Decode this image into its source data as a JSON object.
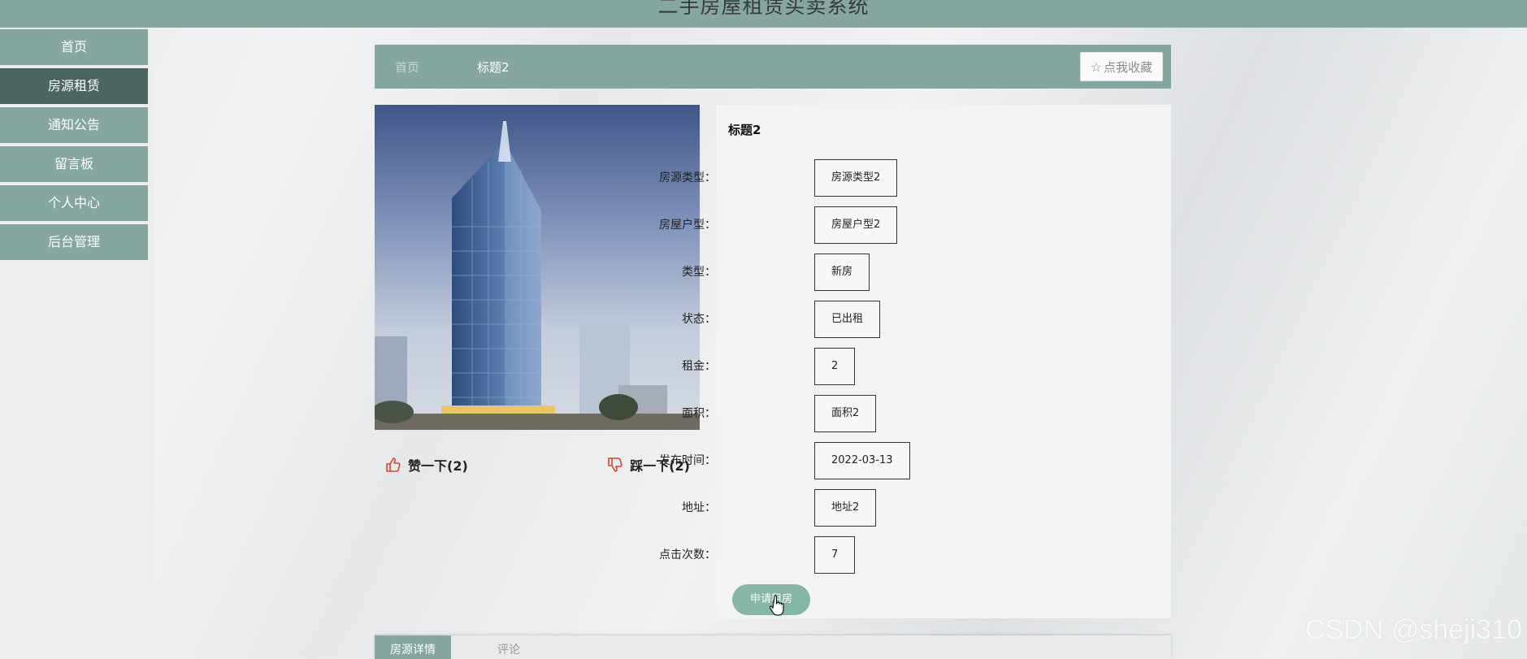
{
  "header": {
    "site_title": "二手房屋租赁买卖系统"
  },
  "sidebar": {
    "items": [
      {
        "label": "首页"
      },
      {
        "label": "房源租赁",
        "active": true
      },
      {
        "label": "通知公告"
      },
      {
        "label": "留言板"
      },
      {
        "label": "个人中心"
      },
      {
        "label": "后台管理"
      }
    ]
  },
  "breadcrumb": {
    "home": "首页",
    "current": "标题2",
    "favorite_label": "点我收藏",
    "favorite_icon": "star-outline-icon"
  },
  "votes": {
    "like_label": "赞一下(2)",
    "like_icon": "thumbs-up-icon",
    "dislike_label": "踩一下(2)",
    "dislike_icon": "thumbs-down-icon"
  },
  "detail": {
    "title": "标题2",
    "fields": [
      {
        "label": "房源类型：",
        "value": "房源类型2"
      },
      {
        "label": "房屋户型：",
        "value": "房屋户型2"
      },
      {
        "label": "类型：",
        "value": "新房"
      },
      {
        "label": "状态：",
        "value": "已出租"
      },
      {
        "label": "租金：",
        "value": "2"
      },
      {
        "label": "面积：",
        "value": "面积2"
      },
      {
        "label": "发布时间：",
        "value": "2022-03-13"
      },
      {
        "label": "地址：",
        "value": "地址2"
      },
      {
        "label": "点击次数：",
        "value": "7"
      }
    ],
    "apply_label": "申请租房"
  },
  "tabs": [
    {
      "label": "房源详情",
      "active": true
    },
    {
      "label": "评论",
      "active": false
    }
  ],
  "watermark": "CSDN @sheji310",
  "colors": {
    "theme": "#85a7a0",
    "active_nav": "#4b6661",
    "apply_button": "#85b6a8",
    "vote_icon": "#d9432f"
  }
}
